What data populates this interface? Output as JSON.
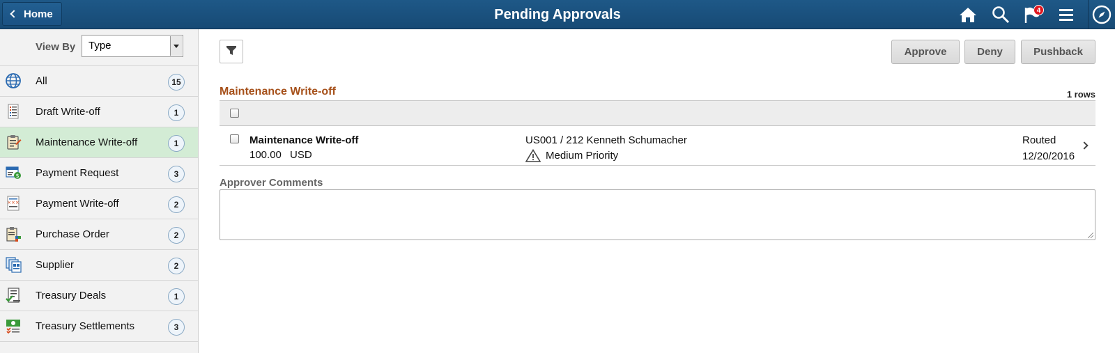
{
  "header": {
    "home_label": "Home",
    "title": "Pending Approvals",
    "notification_count": "4",
    "icons": [
      "home-icon",
      "search-icon",
      "notifications-flag-icon",
      "menu-icon",
      "navbar-compass-icon"
    ]
  },
  "sidebar": {
    "view_by_label": "View By",
    "view_by_value": "Type",
    "items": [
      {
        "label": "All",
        "count": "15",
        "icon": "globe-icon"
      },
      {
        "label": "Draft Write-off",
        "count": "1",
        "icon": "draft-document-icon"
      },
      {
        "label": "Maintenance Write-off",
        "count": "1",
        "icon": "clipboard-icon",
        "selected": true
      },
      {
        "label": "Payment Request",
        "count": "3",
        "icon": "payment-request-icon"
      },
      {
        "label": "Payment Write-off",
        "count": "2",
        "icon": "payment-writeoff-icon"
      },
      {
        "label": "Purchase Order",
        "count": "2",
        "icon": "purchase-order-icon"
      },
      {
        "label": "Supplier",
        "count": "2",
        "icon": "supplier-icon"
      },
      {
        "label": "Treasury Deals",
        "count": "1",
        "icon": "treasury-deals-icon"
      },
      {
        "label": "Treasury Settlements",
        "count": "3",
        "icon": "treasury-settlements-icon"
      }
    ]
  },
  "main": {
    "buttons": {
      "approve": "Approve",
      "deny": "Deny",
      "pushback": "Pushback"
    },
    "grid_title": "Maintenance Write-off",
    "rows_count": "1 rows",
    "row": {
      "title": "Maintenance Write-off",
      "amount": "100.00",
      "currency": "USD",
      "business_unit": "US001 / 212  Kenneth Schumacher",
      "priority": "Medium Priority",
      "status": "Routed",
      "date": "12/20/2016"
    },
    "comments_label": "Approver Comments",
    "comments_value": ""
  },
  "colors": {
    "header_bg": "#1d5584",
    "selected_item_bg": "#d3ecd5",
    "grid_title": "#a6511b"
  }
}
